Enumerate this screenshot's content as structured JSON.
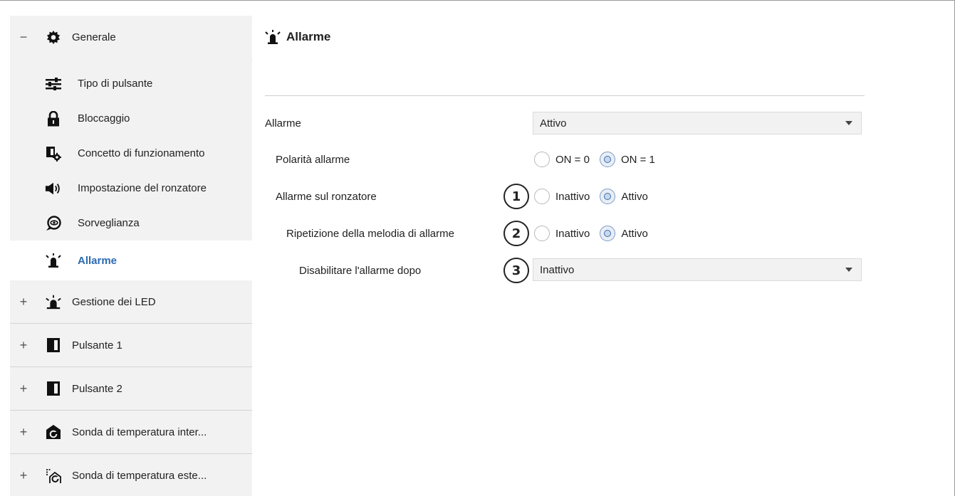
{
  "sidebar": {
    "general": {
      "toggle": "−",
      "label": "Generale"
    },
    "sub_items": [
      {
        "label": "Tipo di pulsante",
        "icon": "sliders-icon"
      },
      {
        "label": "Bloccaggio",
        "icon": "lock-icon"
      },
      {
        "label": "Concetto di funzionamento",
        "icon": "settings-concept-icon"
      },
      {
        "label": "Impostazione del ronzatore",
        "icon": "speaker-icon"
      },
      {
        "label": "Sorveglianza",
        "icon": "chat-eye-icon"
      },
      {
        "label": "Allarme",
        "icon": "alarm-light-icon",
        "active": true
      }
    ],
    "groups": [
      {
        "toggle": "+",
        "label": "Gestione dei LED",
        "icon": "led-icon"
      },
      {
        "toggle": "+",
        "label": "Pulsante 1",
        "icon": "button-icon"
      },
      {
        "toggle": "+",
        "label": "Pulsante 2",
        "icon": "button-icon"
      },
      {
        "toggle": "+",
        "label": "Sonda di temperatura inter...",
        "icon": "internal-temp-sensor-icon"
      },
      {
        "toggle": "+",
        "label": "Sonda di temperatura este...",
        "icon": "external-temp-sensor-icon"
      }
    ]
  },
  "main": {
    "title": "Allarme",
    "params": {
      "allarme": {
        "label": "Allarme",
        "value": "Attivo"
      },
      "polarita": {
        "label": "Polarità allarme",
        "opt1": "ON = 0",
        "opt2": "ON = 1",
        "selected": "ON = 1"
      },
      "ronzatore": {
        "label": "Allarme sul ronzatore",
        "opt1": "Inattivo",
        "opt2": "Attivo",
        "selected": "Attivo",
        "callout": "1"
      },
      "ripetizione": {
        "label": "Ripetizione della melodia di allarme",
        "opt1": "Inattivo",
        "opt2": "Attivo",
        "selected": "Attivo",
        "callout": "2"
      },
      "disabilitare": {
        "label": "Disabilitare l'allarme dopo",
        "value": "Inattivo",
        "callout": "3"
      }
    }
  },
  "colors": {
    "active_text": "#2c6bb0",
    "sidebar_bg": "#f2f2f2",
    "radio_selected": "#3c6fb0"
  }
}
